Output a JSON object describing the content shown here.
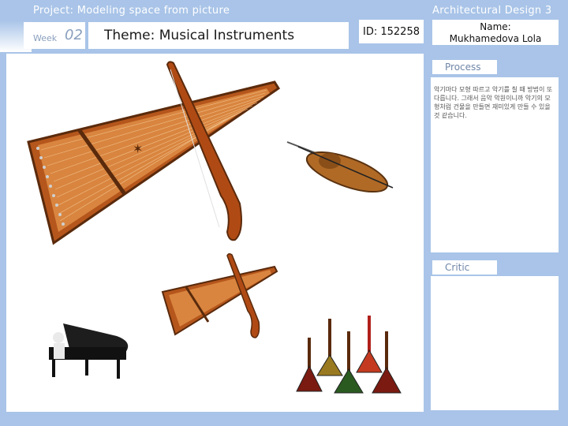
{
  "header": {
    "project": "Project: Modeling space from picture",
    "course": "Architectural Design  3"
  },
  "week": {
    "label": "Week",
    "number": "02"
  },
  "theme": "Theme: Musical Instruments",
  "id_label": "ID: 152258",
  "name_label": "Name: Mukhamedova Lola",
  "sections": {
    "process": "Process",
    "critic": "Critic"
  },
  "process_text": "악기마다 모형 따르고 악기를 칠 때 방법이 또 다릅니다. 그래서   음악 악원이니까  악기의 모형처럼 건물을 만들면 재미있게 만들 수 있을 것 같습니다.",
  "critic_text": "",
  "images": [
    {
      "name": "zither-large",
      "desc": "psaltery"
    },
    {
      "name": "violin",
      "desc": "violin"
    },
    {
      "name": "zither-small",
      "desc": "psaltery"
    },
    {
      "name": "piano",
      "desc": "grand piano"
    },
    {
      "name": "balalaikas",
      "desc": "balalaikas"
    }
  ],
  "colors": {
    "background": "#a9c4e8",
    "panel": "#ffffff",
    "header_text": "#ffffff",
    "section_label": "#6f86a8",
    "wood": "#c8692a"
  }
}
